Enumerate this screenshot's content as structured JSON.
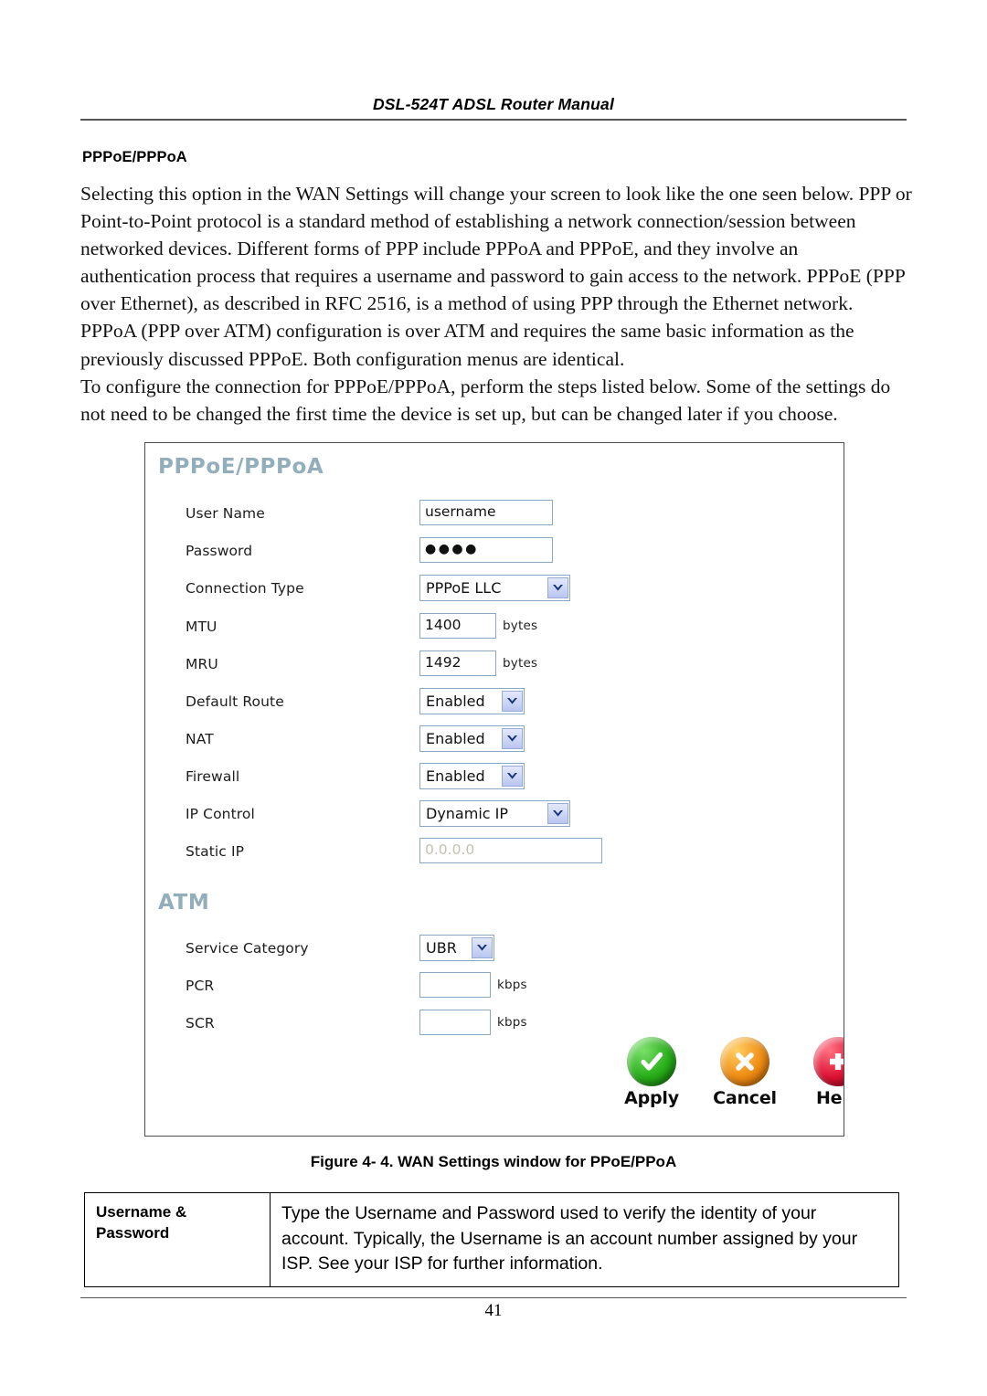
{
  "document": {
    "running_header": "DSL-524T ADSL Router Manual",
    "section_heading": "PPPoE/PPPoA",
    "page_number": "41",
    "body_paragraphs": [
      "Selecting this option in the WAN Settings will change your screen to look like the one seen below. PPP or Point-to-Point protocol is a standard method of establishing a network connection/session between networked devices. Different forms of PPP include PPPoA and PPPoE, and they involve an authentication process that requires a username and password to gain access to the network. PPPoE (PPP over Ethernet), as described in RFC 2516, is a method of using PPP through the Ethernet network. PPPoA (PPP over ATM) configuration is over ATM and requires the same basic information as the previously discussed PPPoE. Both configuration menus are identical.",
      "To configure the connection for PPPoE/PPPoA, perform the steps listed below. Some of the settings do not need to be changed the first time the device is set up, but can be changed later if you choose."
    ],
    "figure_caption": "Figure 4- 4. WAN Settings window for PPoE/PPoA"
  },
  "screenshot": {
    "pppoe_section": {
      "title": "PPPoE/PPPoA",
      "fields": {
        "user_name": {
          "label": "User Name",
          "value": "username"
        },
        "password": {
          "label": "Password",
          "value": "●●●●"
        },
        "connection_type": {
          "label": "Connection Type",
          "value": "PPPoE LLC"
        },
        "mtu": {
          "label": "MTU",
          "value": "1400",
          "unit": "bytes"
        },
        "mru": {
          "label": "MRU",
          "value": "1492",
          "unit": "bytes"
        },
        "default_route": {
          "label": "Default Route",
          "value": "Enabled"
        },
        "nat": {
          "label": "NAT",
          "value": "Enabled"
        },
        "firewall": {
          "label": "Firewall",
          "value": "Enabled"
        },
        "ip_control": {
          "label": "IP Control",
          "value": "Dynamic IP"
        },
        "static_ip": {
          "label": "Static IP",
          "value": "0.0.0.0"
        }
      }
    },
    "atm_section": {
      "title": "ATM",
      "fields": {
        "service_category": {
          "label": "Service Category",
          "value": "UBR"
        },
        "pcr": {
          "label": "PCR",
          "value": "",
          "unit": "kbps"
        },
        "scr": {
          "label": "SCR",
          "value": "",
          "unit": "kbps"
        }
      }
    },
    "actions": [
      {
        "label": "Apply",
        "icon": "check-circle-icon",
        "color": "#27ad18"
      },
      {
        "label": "Cancel",
        "icon": "x-circle-icon",
        "color": "#ee8b12"
      },
      {
        "label": "Help",
        "icon": "plus-circle-icon",
        "color": "#dd1133"
      }
    ],
    "colors": {
      "heading": "#93aebb",
      "input_border": "#8aa7c4",
      "dropdown_button": "#b9c6f0"
    }
  },
  "description_table": {
    "rows": [
      {
        "key": "Username & Password",
        "value": "Type the Username and Password used to verify the identity of your account. Typically, the Username is an account number assigned by your ISP. See your ISP for further information."
      }
    ]
  }
}
